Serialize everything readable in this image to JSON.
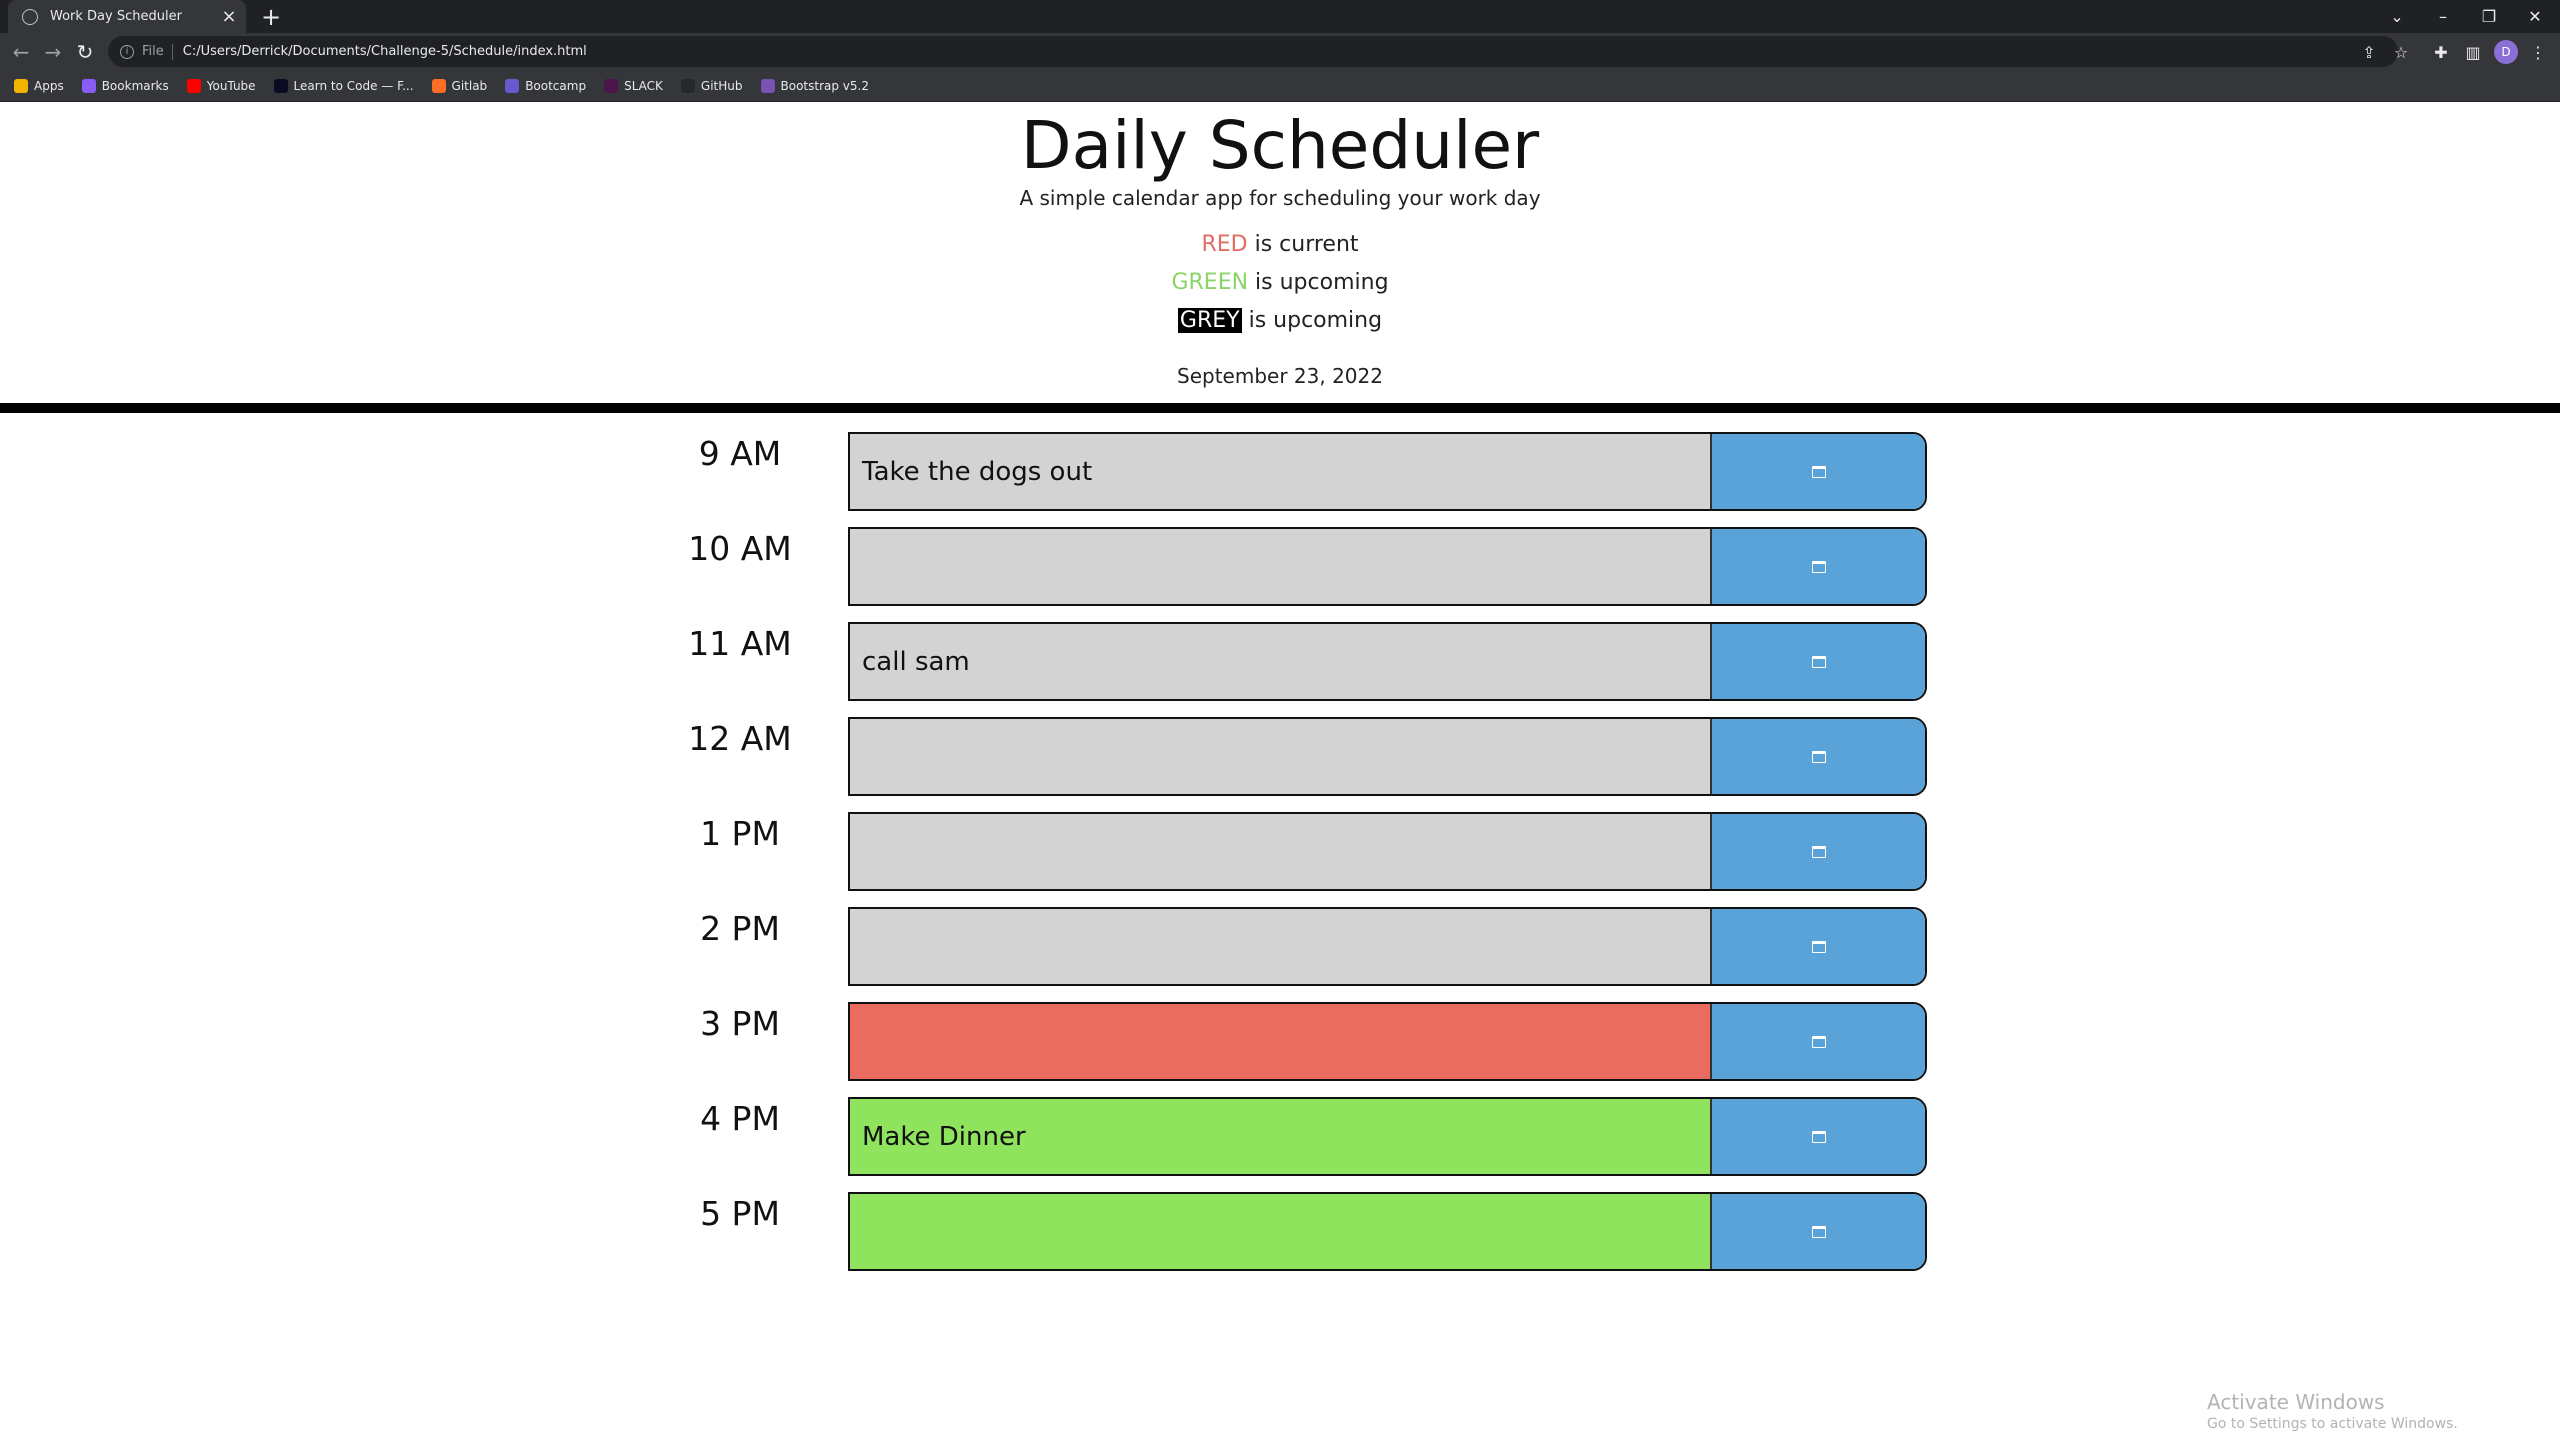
{
  "browser": {
    "tab_title": "Work Day Scheduler",
    "tab_close": "×",
    "new_tab": "+",
    "scheme_label": "File",
    "url": "C:/Users/Derrick/Documents/Challenge-5/Schedule/index.html",
    "profile_initial": "D",
    "bookmarks": [
      {
        "label": "Apps",
        "icon": "apps-grid-icon",
        "color": "#f4b400"
      },
      {
        "label": "Bookmarks",
        "icon": "star-icon",
        "color": "#8a5cf6"
      },
      {
        "label": "YouTube",
        "icon": "youtube-icon",
        "color": "#ff0000"
      },
      {
        "label": "Learn to Code — F...",
        "icon": "code-icon",
        "color": "#0a0a23"
      },
      {
        "label": "Gitlab",
        "icon": "gitlab-icon",
        "color": "#fc6d26"
      },
      {
        "label": "Bootcamp",
        "icon": "bootcamp-icon",
        "color": "#6a5acd"
      },
      {
        "label": "SLACK",
        "icon": "slack-icon",
        "color": "#4a154b"
      },
      {
        "label": "GitHub",
        "icon": "github-icon",
        "color": "#24292e"
      },
      {
        "label": "Bootstrap v5.2",
        "icon": "bootstrap-icon",
        "color": "#7952b3"
      }
    ]
  },
  "header": {
    "title": "Daily Scheduler",
    "subtitle": "A simple calendar app for scheduling your work day",
    "legend": {
      "red_word": "RED",
      "red_text": "is current",
      "green_word": "GREEN",
      "green_text": "is upcoming",
      "grey_word": "GREY",
      "grey_text": "is upcoming"
    },
    "date": "September 23, 2022"
  },
  "schedule": [
    {
      "hour": "9 AM",
      "task": "Take the dogs out",
      "state": "past"
    },
    {
      "hour": "10 AM",
      "task": "",
      "state": "past"
    },
    {
      "hour": "11 AM",
      "task": "call sam",
      "state": "past"
    },
    {
      "hour": "12 AM",
      "task": "",
      "state": "past"
    },
    {
      "hour": "1 PM",
      "task": "",
      "state": "past"
    },
    {
      "hour": "2 PM",
      "task": "",
      "state": "past"
    },
    {
      "hour": "3 PM",
      "task": "",
      "state": "present"
    },
    {
      "hour": "4 PM",
      "task": "Make Dinner",
      "state": "future"
    },
    {
      "hour": "5 PM",
      "task": "",
      "state": "future"
    }
  ],
  "colors": {
    "past": "#d3d3d3",
    "present": "#e86c60",
    "future": "#8fe35d",
    "save": "#5aa3d9"
  },
  "watermark": {
    "line1": "Activate Windows",
    "line2": "Go to Settings to activate Windows."
  }
}
